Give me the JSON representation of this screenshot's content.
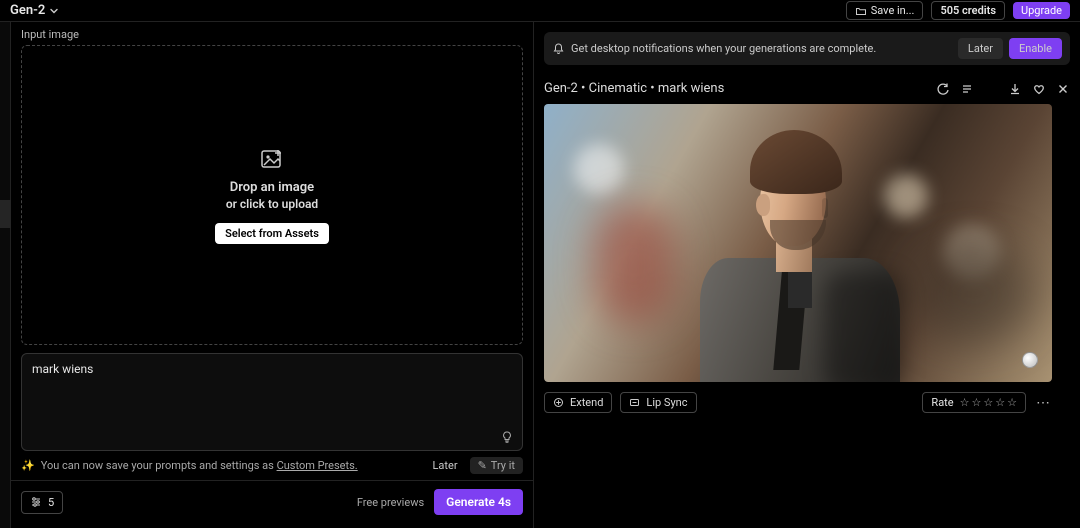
{
  "topbar": {
    "model_name": "Gen-2",
    "save_label": "Save in...",
    "credits": "505 credits",
    "upgrade_label": "Upgrade"
  },
  "left": {
    "section_label": "Input image",
    "dropzone_line1": "Drop an image",
    "dropzone_line2": "or click to upload",
    "assets_btn": "Select from Assets",
    "prompt_value": "mark wiens",
    "tip_prefix": "You can now save your prompts and settings as ",
    "tip_link": "Custom Presets.",
    "tip_later": "Later",
    "tip_try": "Try it",
    "settings_count": "5",
    "free_previews": "Free previews",
    "generate_label": "Generate 4s"
  },
  "right": {
    "notify_text": "Get desktop notifications when your generations are complete.",
    "notify_later": "Later",
    "notify_enable": "Enable",
    "result_title": "Gen-2 • Cinematic • mark wiens",
    "extend_label": "Extend",
    "lipsync_label": "Lip Sync",
    "rate_label": "Rate"
  }
}
